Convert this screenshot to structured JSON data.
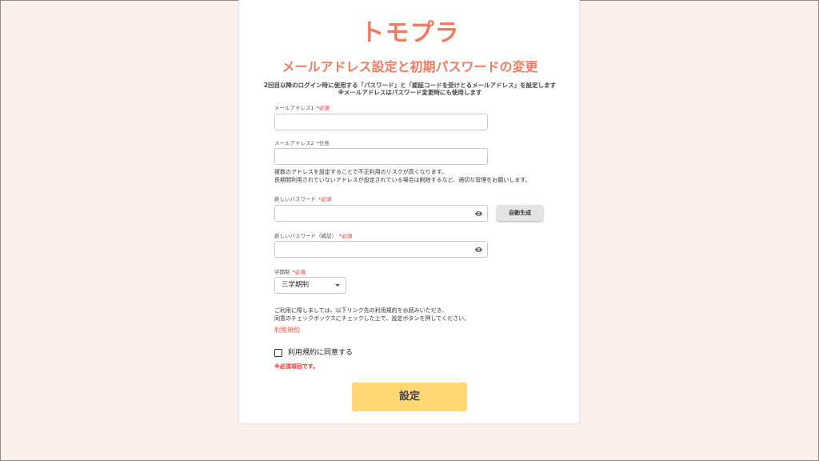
{
  "brand": {
    "logo": "トモプラ",
    "color": "#ee7c61"
  },
  "page": {
    "title": "メールアドレス設定と初期パスワードの変更",
    "description_line1": "2回目以降のログイン時に使用する「パスワード」と「認証コードを受けとるメールアドレス」を設定します",
    "description_line2": "※メールアドレスはパスワード変更時にも使用します"
  },
  "form": {
    "email1": {
      "label": "メールアドレス1",
      "badge": "*必須",
      "value": ""
    },
    "email2": {
      "label": "メールアドレス2",
      "badge": "*任意",
      "value": ""
    },
    "email_note_line1": "複数のアドレスを設定することで不正利用のリスクが高くなります。",
    "email_note_line2": "長期間利用されていないアドレスが設定されている場合は削除するなど、適切な管理をお願いします。",
    "new_password": {
      "label": "新しいパスワード",
      "badge": "*必須",
      "value": "",
      "toggle_icon": "eye-icon"
    },
    "auto_generate_label": "自動生成",
    "confirm_password": {
      "label": "新しいパスワード（確認）",
      "badge": "*必須",
      "value": "",
      "toggle_icon": "eye-icon"
    },
    "term_system": {
      "label": "学期制",
      "badge": "*必須",
      "selected": "三学期制"
    },
    "terms_text_line1": "ご利用に際しましては、以下リンク先の利用規約をお読みいただき、",
    "terms_text_line2": "同意のチェックボックスにチェックした上で、設定ボタンを押してください。",
    "terms_link": "利用規約",
    "agree_label": "利用規約に同意する",
    "agree_checked": false,
    "required_note": "※必須項目です。",
    "submit_label": "設定"
  },
  "colors": {
    "background": "#fbefec",
    "accent": "#ee7c61",
    "required": "#e0322b",
    "submit": "#ffd873"
  }
}
